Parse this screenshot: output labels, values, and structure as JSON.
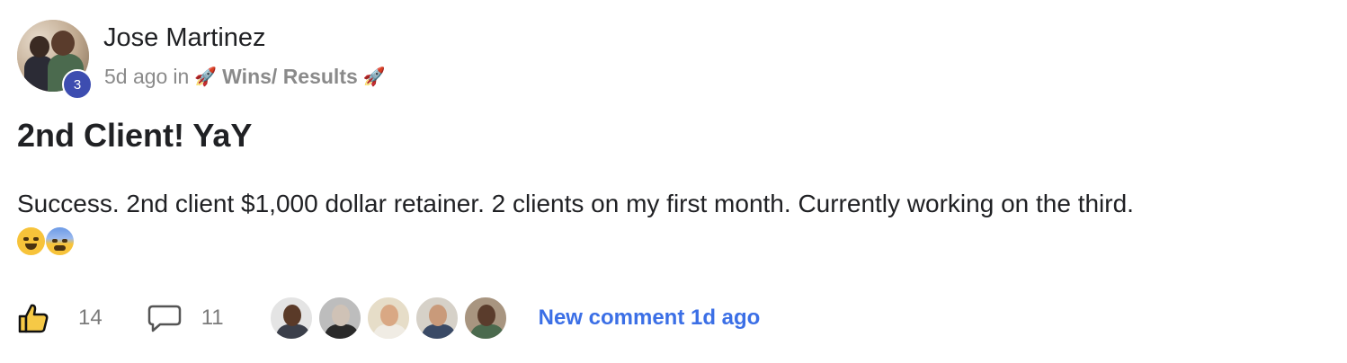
{
  "post": {
    "author": {
      "name": "Jose Martinez",
      "level": "3"
    },
    "meta": {
      "time_ago": "5d ago",
      "in_label": "in",
      "category_prefix_icon": "rocket-icon",
      "category": "Wins/ Results",
      "category_suffix_icon": "rocket-icon"
    },
    "title": "2nd Client! YaY",
    "body": "Success. 2nd client $1,000 dollar retainer. 2 clients on my first month. Currently working on the third.",
    "emojis": [
      "grinning-sweat-emoji",
      "fearful-sweat-emoji"
    ]
  },
  "footer": {
    "like_icon": "thumbs-up-icon",
    "like_count": "14",
    "comment_icon": "comment-bubble-icon",
    "comment_count": "11",
    "commenter_count": 5,
    "new_comment_label": "New comment 1d ago"
  },
  "colors": {
    "level_badge": "#3d4db0",
    "link_blue": "#3b6fe6",
    "muted_text": "#8a8a8a"
  }
}
